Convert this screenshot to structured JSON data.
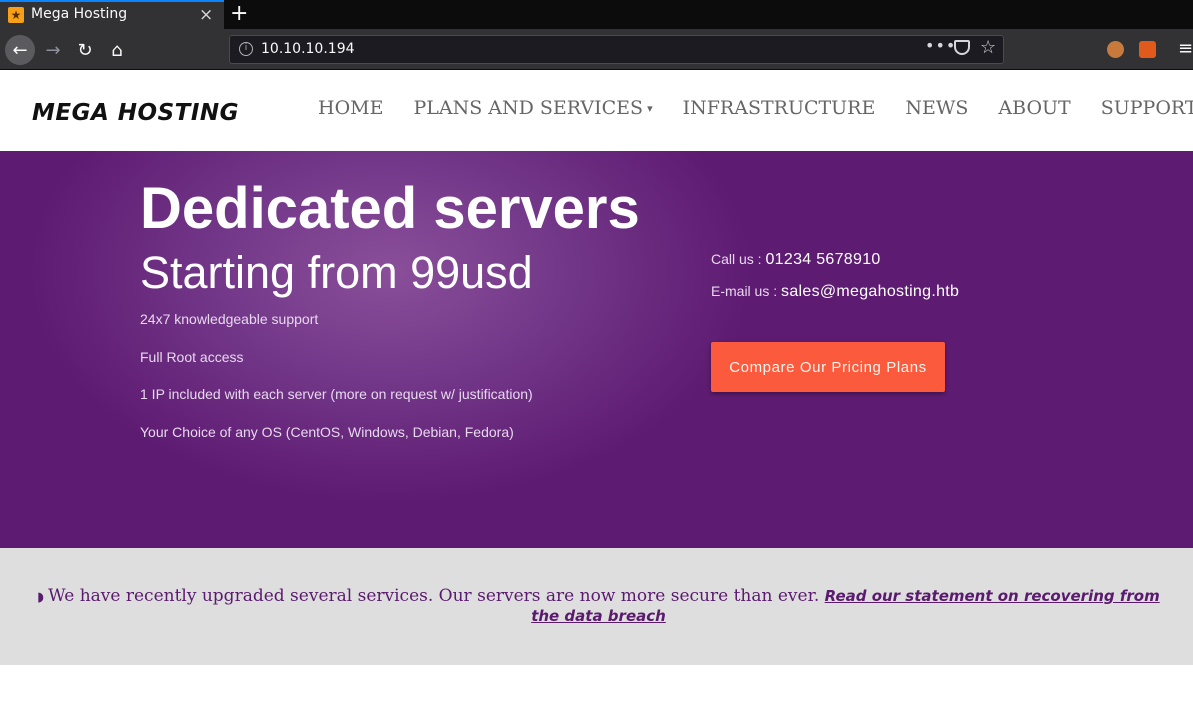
{
  "browser": {
    "tab_title": "Mega Hosting",
    "tab_close": "×",
    "new_tab": "+",
    "url": "10.10.10.194",
    "url_info_icon": "i",
    "more_icon": "•••",
    "star_icon": "☆",
    "menu_icon": "≡",
    "back_icon": "←",
    "forward_icon": "→",
    "reload_icon": "↻",
    "home_icon": "⌂",
    "accent_color": "#0a84ff"
  },
  "site": {
    "logo": "MEGA HOSTING",
    "menu": {
      "home": "HOME",
      "plans": "PLANS AND SERVICES",
      "plans_caret": "▾",
      "infrastructure": "INFRASTRUCTURE",
      "news": "NEWS",
      "about": "ABOUT",
      "support": "SUPPORT"
    }
  },
  "hero": {
    "title": "Dedicated servers",
    "subtitle": "Starting from 99usd",
    "features": [
      "24x7 knowledgeable support",
      "Full Root access",
      "1 IP included with each server (more on request w/ justification)",
      "Your Choice of any OS (CentOS, Windows, Debian, Fedora)"
    ],
    "call_label": "Call us : ",
    "call_value": "01234 5678910",
    "email_label": "E-mail us : ",
    "email_value": "sales@megahosting.htb",
    "cta_label": "Compare Our Pricing Plans",
    "background_color": "#5e1b72",
    "cta_color": "#fb5a3c"
  },
  "notice": {
    "rss_icon": "◗",
    "text": "We have recently upgraded several services. Our servers are now more secure than ever. ",
    "link_text": "Read our statement on recovering from the data breach"
  }
}
